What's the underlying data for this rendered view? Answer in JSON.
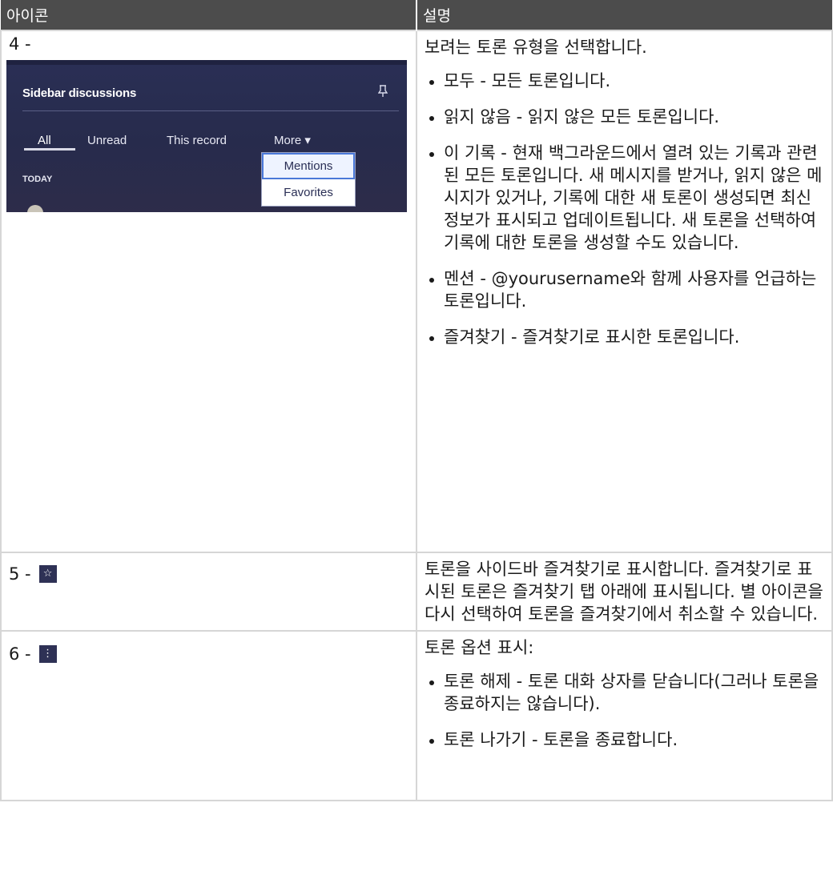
{
  "header": {
    "col1": "아이콘",
    "col2": "설명"
  },
  "rows": [
    {
      "number": "4 -",
      "screenshot": {
        "title": "Sidebar discussions",
        "pin_icon": "pin-icon",
        "tabs": [
          "All",
          "Unread",
          "This record",
          "More ▾"
        ],
        "section": "TODAY",
        "menu": [
          "Mentions",
          "Favorites"
        ]
      },
      "lead": "보려는 토론 유형을 선택합니다.",
      "bullets": [
        "모두 - 모든 토론입니다.",
        "읽지 않음 - 읽지 않은 모든 토론입니다.",
        "이 기록 - 현재 백그라운드에서 열려 있는 기록과 관련된 모든 토론입니다. 새 메시지를 받거나, 읽지 않은 메시지가 있거나, 기록에 대한 새 토론이 생성되면 최신 정보가 표시되고 업데이트됩니다. 새 토론을 선택하여 기록에 대한 토론을 생성할 수도 있습니다.",
        "멘션 - @yourusername와 함께 사용자를 언급하는 토론입니다.",
        "즐겨찾기 - 즐겨찾기로 표시한 토론입니다."
      ]
    },
    {
      "number": "5 -",
      "icon": "☆",
      "description": "토론을 사이드바 즐겨찾기로 표시합니다. 즐겨찾기로 표시된 토론은 즐겨찾기 탭 아래에 표시됩니다. 별 아이콘을 다시 선택하여 토론을 즐겨찾기에서 취소할 수 있습니다."
    },
    {
      "number": "6 -",
      "icon": "⋮",
      "lead": "토론 옵션 표시:",
      "bullets": [
        "토론 해제 - 토론 대화 상자를 닫습니다(그러나 토론을 종료하지는 않습니다).",
        "토론 나가기 - 토론을 종료합니다."
      ]
    }
  ]
}
